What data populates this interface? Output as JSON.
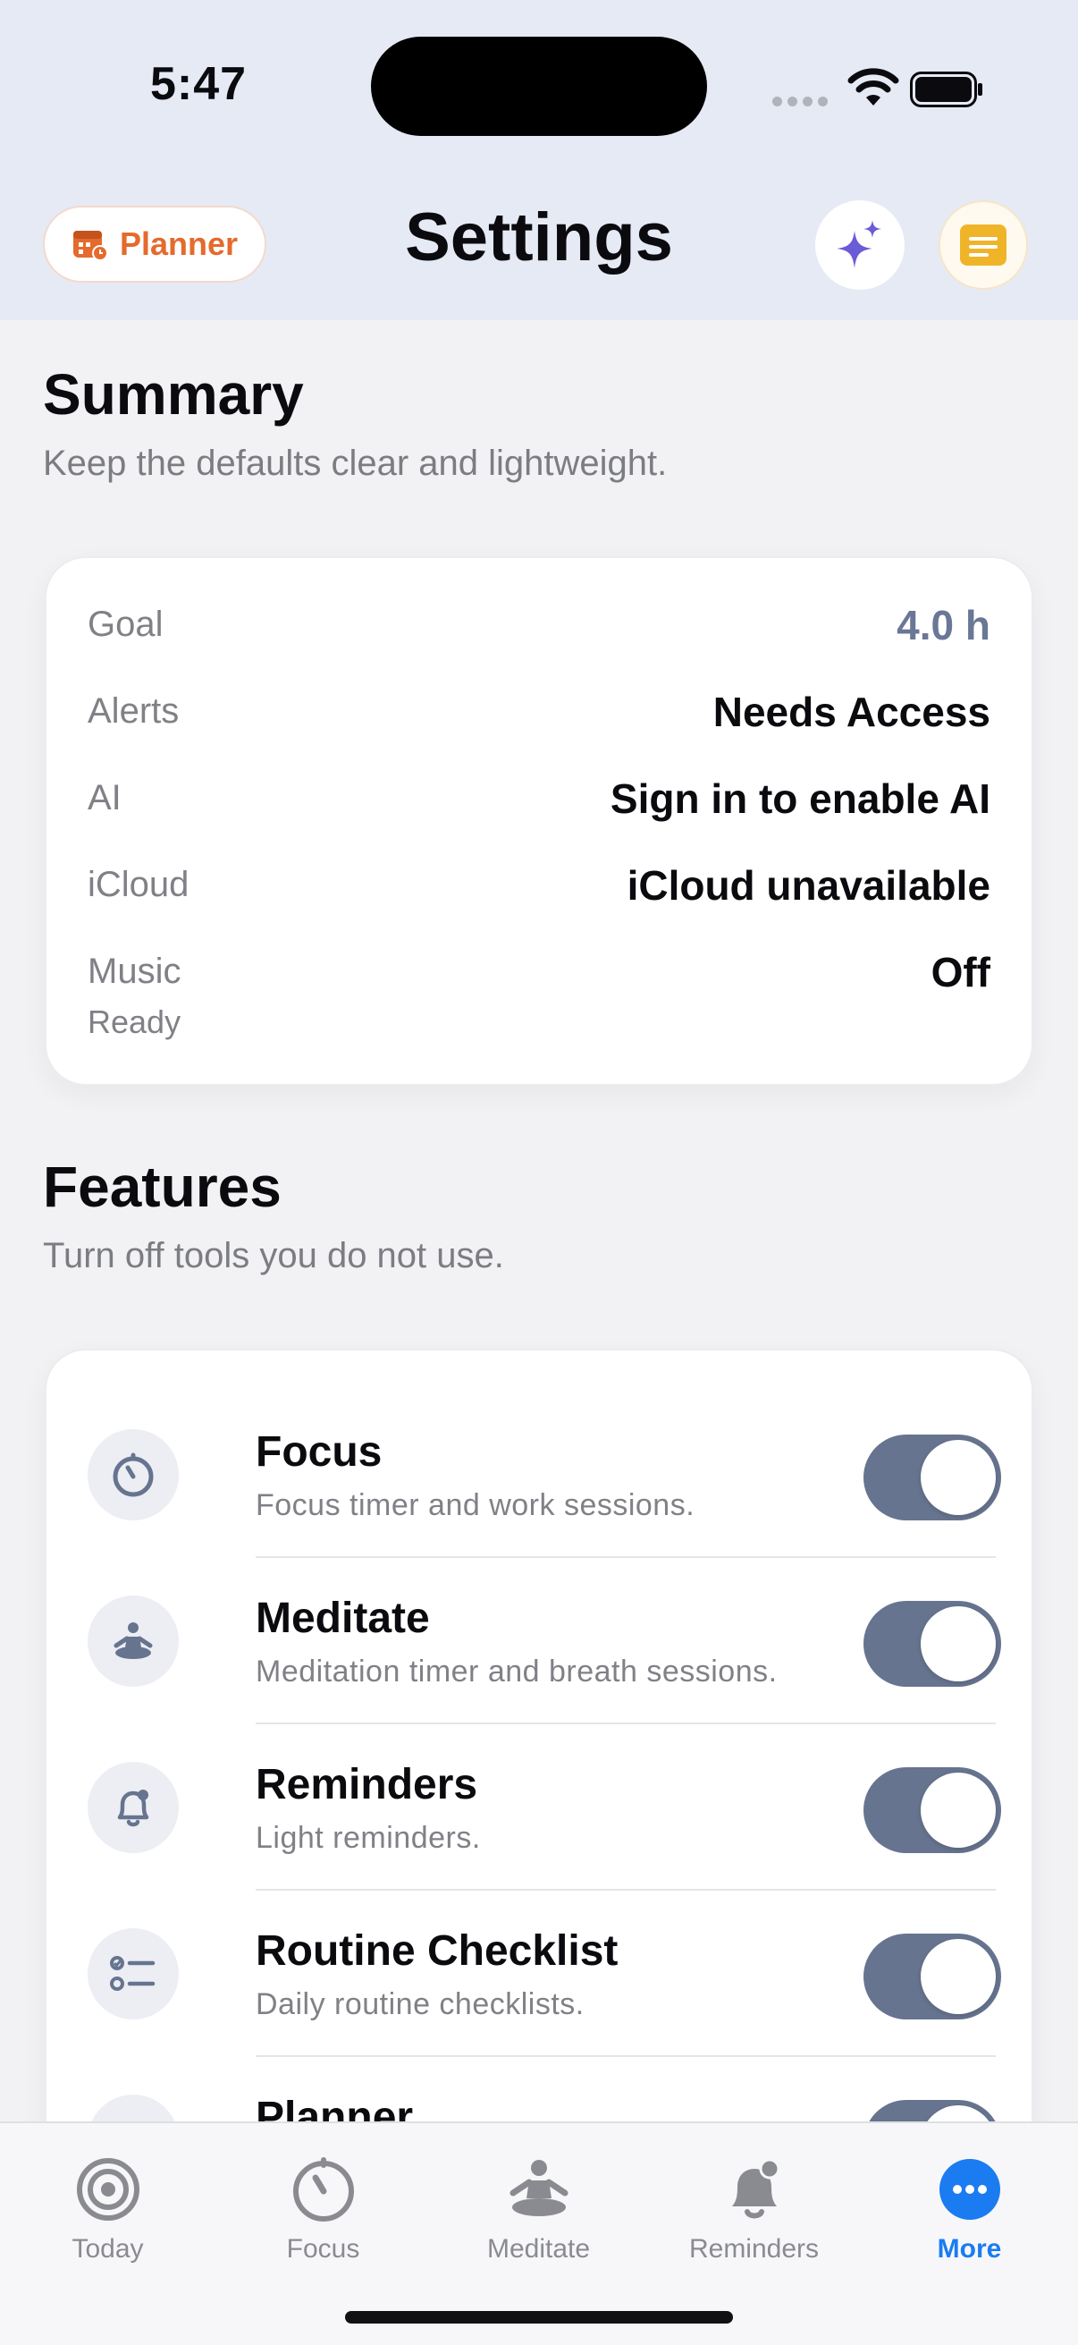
{
  "status_bar": {
    "time": "5:47"
  },
  "header": {
    "planner_label": "Planner",
    "title": "Settings",
    "ai_icon": "sparkles-icon",
    "notes_icon": "notes-icon"
  },
  "summary": {
    "title": "Summary",
    "subtitle": "Keep the defaults clear and lightweight.",
    "rows": [
      {
        "label": "Goal",
        "value": "4.0 h"
      },
      {
        "label": "Alerts",
        "value": "Needs Access"
      },
      {
        "label": "AI",
        "value": "Sign in to enable AI"
      },
      {
        "label": "iCloud",
        "value": "iCloud unavailable"
      },
      {
        "label": "Music",
        "value": "Off",
        "sub": "Ready"
      }
    ]
  },
  "features": {
    "title": "Features",
    "subtitle": "Turn off tools you do not use.",
    "items": [
      {
        "title": "Focus",
        "desc": "Focus timer and work sessions.",
        "enabled": true,
        "icon": "timer-icon"
      },
      {
        "title": "Meditate",
        "desc": "Meditation timer and breath sessions.",
        "enabled": true,
        "icon": "meditate-icon"
      },
      {
        "title": "Reminders",
        "desc": "Light reminders.",
        "enabled": true,
        "icon": "bell-icon"
      },
      {
        "title": "Routine Checklist",
        "desc": "Daily routine checklists.",
        "enabled": true,
        "icon": "checklist-icon"
      },
      {
        "title": "Planner",
        "desc": "",
        "enabled": true,
        "icon": "calendar-icon"
      }
    ]
  },
  "tab_bar": {
    "tabs": [
      {
        "label": "Today",
        "icon": "target-icon"
      },
      {
        "label": "Focus",
        "icon": "timer-icon"
      },
      {
        "label": "Meditate",
        "icon": "meditate-icon"
      },
      {
        "label": "Reminders",
        "icon": "bell-icon"
      },
      {
        "label": "More",
        "icon": "more-icon",
        "active": true
      }
    ]
  },
  "colors": {
    "accent": "#1a7cf0",
    "toggle_on": "#67748f",
    "planner": "#e56a2d",
    "ai": "#6a5bd6",
    "notes": "#f0b429"
  }
}
